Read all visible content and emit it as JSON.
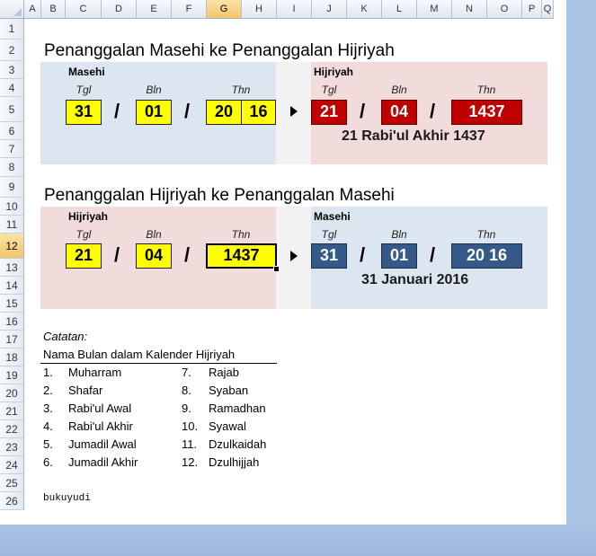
{
  "columns": [
    "A",
    "B",
    "C",
    "D",
    "E",
    "F",
    "G",
    "H",
    "I",
    "J",
    "K",
    "L",
    "M",
    "N",
    "O",
    "P",
    "Q"
  ],
  "rows": [
    "1",
    "2",
    "3",
    "4",
    "5",
    "6",
    "7",
    "8",
    "9",
    "10",
    "11",
    "12",
    "13",
    "14",
    "15",
    "16",
    "17",
    "18",
    "19",
    "20",
    "21",
    "22",
    "23",
    "24",
    "25",
    "26"
  ],
  "section1": {
    "title": "Penanggalan Masehi ke Penanggalan Hijriyah",
    "left_label": "Masehi",
    "right_label": "Hijriyah",
    "sub_tgl": "Tgl",
    "sub_bln": "Bln",
    "sub_thn": "Thn",
    "input_tgl": "31",
    "input_bln": "01",
    "input_thn_a": "20",
    "input_thn_b": "16",
    "out_tgl": "21",
    "out_bln": "04",
    "out_thn": "1437",
    "result": "21 Rabi'ul Akhir 1437"
  },
  "section2": {
    "title": "Penanggalan Hijriyah ke Penanggalan Masehi",
    "left_label": "Hijriyah",
    "right_label": "Masehi",
    "sub_tgl": "Tgl",
    "sub_bln": "Bln",
    "sub_thn": "Thn",
    "input_tgl": "21",
    "input_bln": "04",
    "input_thn": "1437",
    "out_tgl": "31",
    "out_bln": "01",
    "out_thn": "20 16",
    "result": "31 Januari 2016"
  },
  "slash": "/",
  "notes": {
    "heading": "Catatan:",
    "subheading": "Nama Bulan dalam Kalender Hijriyah",
    "months_left": [
      {
        "n": "1.",
        "name": "Muharram"
      },
      {
        "n": "2.",
        "name": "Shafar"
      },
      {
        "n": "3.",
        "name": "Rabi'ul Awal"
      },
      {
        "n": "4.",
        "name": "Rabi'ul Akhir"
      },
      {
        "n": "5.",
        "name": "Jumadil Awal"
      },
      {
        "n": "6.",
        "name": "Jumadil Akhir"
      }
    ],
    "months_right": [
      {
        "n": "7.",
        "name": "Rajab"
      },
      {
        "n": "8.",
        "name": "Syaban"
      },
      {
        "n": "9.",
        "name": "Ramadhan"
      },
      {
        "n": "10.",
        "name": "Syawal"
      },
      {
        "n": "11.",
        "name": "Dzulkaidah"
      },
      {
        "n": "12.",
        "name": "Dzulhijjah"
      }
    ],
    "credit": "bukuyudi"
  },
  "colors": {
    "yellow": "#ffff00",
    "red": "#c00000",
    "blue": "#355a8a",
    "panel_blue": "#dce6f1",
    "panel_pink": "#f2dcdb",
    "gap_grey": "#f2f2f2"
  },
  "selected_cell": {
    "column": "G",
    "row": "12"
  }
}
